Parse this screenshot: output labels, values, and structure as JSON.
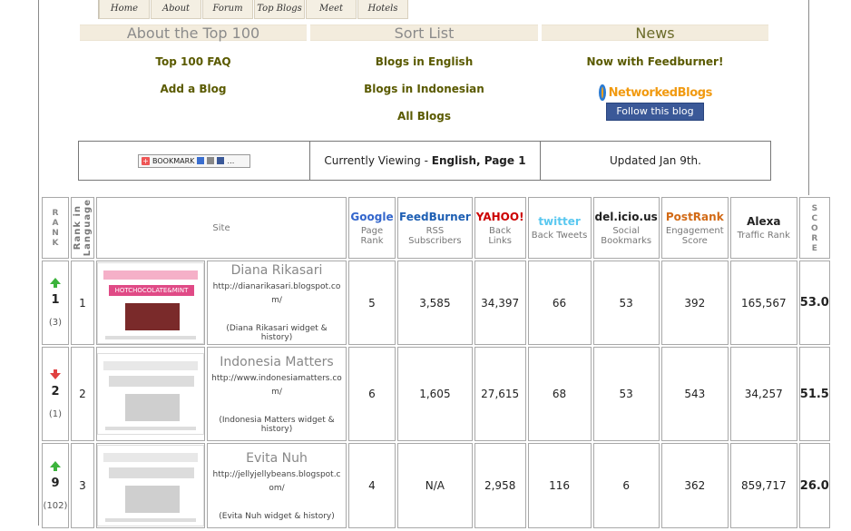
{
  "nav": [
    "Home",
    "About",
    "Forum",
    "Top Blogs",
    "Meet",
    "Hotels"
  ],
  "sections": {
    "about": "About the Top 100",
    "sort": "Sort List",
    "news": "News"
  },
  "links": {
    "faq": "Top 100 FAQ",
    "add": "Add a Blog",
    "english": "Blogs in English",
    "indonesian": "Blogs in Indonesian",
    "all": "All Blogs",
    "feedburner": "Now with Feedburner!"
  },
  "networked": {
    "logo": "NetworkedBlogs",
    "follow": "Follow this blog"
  },
  "info": {
    "bookmark": "BOOKMARK",
    "viewing_prefix": "Currently Viewing - ",
    "viewing_value": "English, Page 1",
    "updated": "Updated Jan 9th."
  },
  "headers": {
    "rank": "RANK",
    "rank_lang": "Rank in Language",
    "site": "Site",
    "score": "SCORE",
    "cols": [
      {
        "logo": "Google",
        "label": "Page Rank",
        "color": "#3366cc"
      },
      {
        "logo": "FeedBurner",
        "label": "RSS Subscribers",
        "color": "#1e5fb3"
      },
      {
        "logo": "YAHOO!",
        "label": "Back Links",
        "color": "#cc0000"
      },
      {
        "logo": "twitter",
        "label": "Back Tweets",
        "color": "#5ac8f0"
      },
      {
        "logo": "del.icio.us",
        "label": "Social Bookmarks",
        "color": "#222"
      },
      {
        "logo": "PostRank",
        "label": "Engagement Score",
        "color": "#d26a16"
      },
      {
        "logo": "Alexa",
        "label": "Traffic Rank",
        "color": "#222"
      }
    ]
  },
  "rows": [
    {
      "trend": "up",
      "rank": "1",
      "prev": "(3)",
      "lang_rank": "1",
      "name": "Diana Rikasari",
      "url": "http://dianarikasari.blogspot.com/",
      "widget": "(Diana Rikasari widget & history)",
      "pagerank": "5",
      "rss": "3,585",
      "backlinks": "34,397",
      "tweets": "66",
      "bookmarks": "53",
      "postrank": "392",
      "alexa": "165,567",
      "score": "53.0",
      "thumb_text": "HOTCHOCOLATE&MINT"
    },
    {
      "trend": "down",
      "rank": "2",
      "prev": "(1)",
      "lang_rank": "2",
      "name": "Indonesia Matters",
      "url": "http://www.indonesiamatters.com/",
      "widget": "(Indonesia Matters widget & history)",
      "pagerank": "6",
      "rss": "1,605",
      "backlinks": "27,615",
      "tweets": "68",
      "bookmarks": "53",
      "postrank": "543",
      "alexa": "34,257",
      "score": "51.5",
      "thumb_text": ""
    },
    {
      "trend": "up",
      "rank": "9",
      "prev": "(102)",
      "lang_rank": "3",
      "name": "Evita Nuh",
      "url": "http://jellyjellybeans.blogspot.com/",
      "widget": "(Evita Nuh widget & history)",
      "pagerank": "4",
      "rss": "N/A",
      "backlinks": "2,958",
      "tweets": "116",
      "bookmarks": "6",
      "postrank": "362",
      "alexa": "859,717",
      "score": "26.0",
      "thumb_text": ""
    }
  ]
}
